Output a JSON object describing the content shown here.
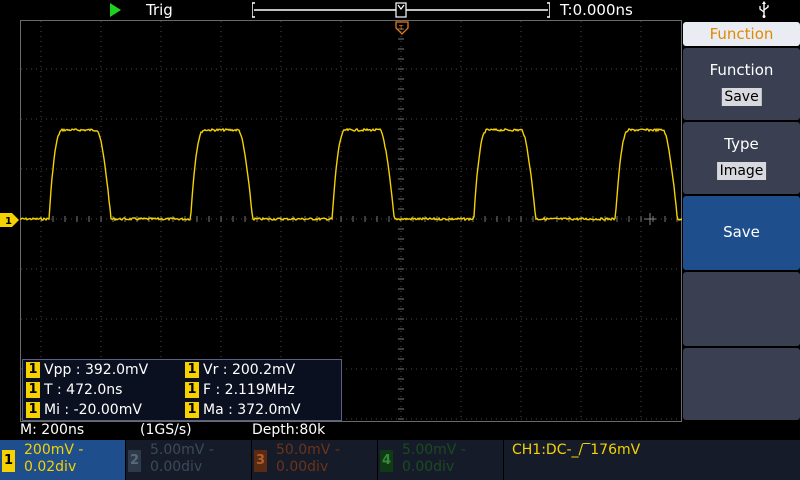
{
  "topbar": {
    "run_state_icon": "play-triangle-icon",
    "trigger_status": "Trig",
    "trigger_time": "T:0.000ns",
    "usb_icon": "usb-icon"
  },
  "colors": {
    "ch1": "#f5d200",
    "ch2": "#2e3a4a",
    "ch3": "#5a2a12",
    "ch4": "#0f3a14",
    "accent_blue": "#1f4e8c",
    "menu_title": "#e08a00"
  },
  "measurements": [
    {
      "channel": "1",
      "text": "Vpp : 392.0mV"
    },
    {
      "channel": "1",
      "text": "Vr : 200.2mV"
    },
    {
      "channel": "1",
      "text": "T : 472.0ns"
    },
    {
      "channel": "1",
      "text": "F : 2.119MHz"
    },
    {
      "channel": "1",
      "text": "Mi : -20.00mV"
    },
    {
      "channel": "1",
      "text": "Ma : 372.0mV"
    }
  ],
  "menu": {
    "title": "Function",
    "function_label": "Function",
    "function_value": "Save",
    "type_label": "Type",
    "type_value": "Image",
    "save_label": "Save"
  },
  "info": {
    "timebase": "M: 200ns",
    "sample_rate": "(1GS/s)",
    "depth": "Depth:80k"
  },
  "channels": [
    {
      "num": "1",
      "volts": "200mV -",
      "offset": "0.02div"
    },
    {
      "num": "2",
      "volts": "5.00mV -",
      "offset": "0.00div"
    },
    {
      "num": "3",
      "volts": "50.0mV -",
      "offset": "0.00div"
    },
    {
      "num": "4",
      "volts": "5.00mV -",
      "offset": "0.00div"
    }
  ],
  "trigger_info": "CH1:DC-_/‾176mV"
}
